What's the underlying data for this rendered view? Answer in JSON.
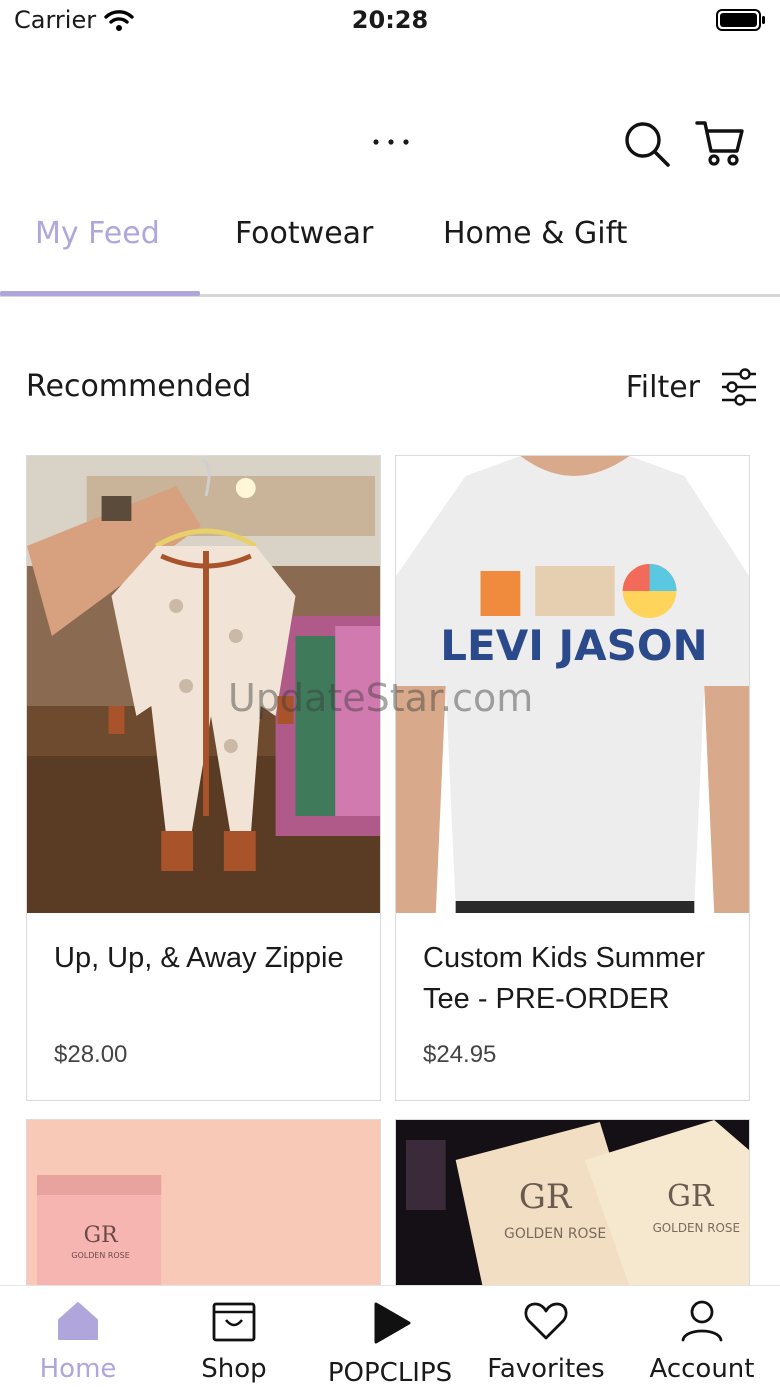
{
  "status_bar": {
    "carrier": "Carrier",
    "time": "20:28"
  },
  "top_bar": {
    "icons": [
      "more-icon",
      "search-icon",
      "cart-icon"
    ]
  },
  "tabs": [
    {
      "label": "My Feed",
      "active": true
    },
    {
      "label": "Footwear",
      "active": false
    },
    {
      "label": "Home & Gift",
      "active": false
    }
  ],
  "section": {
    "title": "Recommended",
    "filter_label": "Filter"
  },
  "products": [
    {
      "title": "Up, Up, & Away Zippie",
      "price": "$28.00"
    },
    {
      "title": "Custom Kids Summer Tee - PRE-ORDER",
      "price": "$24.95"
    },
    {
      "title": "",
      "price": ""
    },
    {
      "title": "",
      "price": ""
    }
  ],
  "images": {
    "shirt_print": "LEVI JASON",
    "brand_logo": "GR",
    "brand_name": "GOLDEN ROSE"
  },
  "watermark": "UpdateStar.com",
  "bottom_nav": [
    {
      "label": "Home",
      "icon": "home-icon",
      "active": true
    },
    {
      "label": "Shop",
      "icon": "shop-icon",
      "active": false
    },
    {
      "label": "POPCLIPS",
      "icon": "play-icon",
      "active": false
    },
    {
      "label": "Favorites",
      "icon": "heart-icon",
      "active": false
    },
    {
      "label": "Account",
      "icon": "account-icon",
      "active": false
    }
  ],
  "colors": {
    "accent": "#b0a6dc",
    "divider": "#d6d6d6",
    "text": "#1a1a1a"
  }
}
